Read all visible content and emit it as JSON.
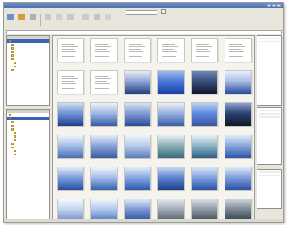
{
  "colors": {
    "accent": "#3a63b5",
    "window": "#e8e5db",
    "titlebar": "#4b6fb0"
  },
  "toolbar": {
    "buttons": [
      {
        "icon": "back-icon",
        "color": "#6b8fd1"
      },
      {
        "icon": "forward-icon",
        "color": "#d89c3c"
      },
      {
        "icon": "up-icon",
        "color": "#b0b0b0"
      },
      {
        "icon": "view-icon",
        "color": "#c7c7c7"
      },
      {
        "icon": "slideshow-icon",
        "color": "#cfcfcf"
      },
      {
        "icon": "edit-icon",
        "color": "#c9c9c9"
      },
      {
        "icon": "print-icon",
        "color": "#cbcbcb"
      },
      {
        "icon": "email-icon",
        "color": "#c4c4c4"
      },
      {
        "icon": "save-icon",
        "color": "#d0d0d0"
      }
    ]
  },
  "thumbnails": [
    {
      "kind": "doc"
    },
    {
      "kind": "doc"
    },
    {
      "kind": "doc"
    },
    {
      "kind": "doc"
    },
    {
      "kind": "doc"
    },
    {
      "kind": "doc"
    },
    {
      "kind": "doc"
    },
    {
      "kind": "doc"
    },
    {
      "kind": "photo",
      "palette": [
        "#2a3f7a",
        "#8ba6d8",
        "#e8ecf4"
      ]
    },
    {
      "kind": "photo",
      "palette": [
        "#1c3fa8",
        "#4a78d8",
        "#9eb8ea"
      ]
    },
    {
      "kind": "photo",
      "palette": [
        "#10182c",
        "#3a4d7a",
        "#6f86b7"
      ]
    },
    {
      "kind": "photo",
      "palette": [
        "#2b4d9b",
        "#a7bde6",
        "#e9eef8"
      ]
    },
    {
      "kind": "photo",
      "palette": [
        "#1f3f8f",
        "#6f93d6",
        "#cfdcf2"
      ]
    },
    {
      "kind": "photo",
      "palette": [
        "#355ba8",
        "#9eb8e4",
        "#ecf0f8"
      ]
    },
    {
      "kind": "photo",
      "palette": [
        "#2c4e98",
        "#7e9bd4",
        "#d9e2f3"
      ]
    },
    {
      "kind": "photo",
      "palette": [
        "#3c5fa6",
        "#95b0de",
        "#eef1f7"
      ]
    },
    {
      "kind": "photo",
      "palette": [
        "#3a54a0",
        "#5d88e0",
        "#bcd0f2"
      ]
    },
    {
      "kind": "photo",
      "palette": [
        "#111827",
        "#2b3f72",
        "#8ba3d4"
      ]
    },
    {
      "kind": "photo",
      "palette": [
        "#4a6fb8",
        "#a6c0e8",
        "#f1f4fa"
      ]
    },
    {
      "kind": "photo",
      "palette": [
        "#3a5ca4",
        "#8aa7da",
        "#e4eaf6"
      ]
    },
    {
      "kind": "photo",
      "palette": [
        "#5a7dbb",
        "#b8cdea",
        "#eef3fa"
      ]
    },
    {
      "kind": "photo",
      "palette": [
        "#3b6a7c",
        "#8bb0b6",
        "#e8f0f1"
      ]
    },
    {
      "kind": "photo",
      "palette": [
        "#2f5f82",
        "#8db8c8",
        "#e7f1f4"
      ]
    },
    {
      "kind": "photo",
      "palette": [
        "#2b56a6",
        "#8aa9df",
        "#dfe8f6"
      ]
    },
    {
      "kind": "photo",
      "palette": [
        "#2a4fa2",
        "#7b9ede",
        "#e2eaf7"
      ]
    },
    {
      "kind": "photo",
      "palette": [
        "#3862b0",
        "#a3bde8",
        "#f0f4fb"
      ]
    },
    {
      "kind": "photo",
      "palette": [
        "#2d59b3",
        "#86a8e3",
        "#e3ebf8"
      ]
    },
    {
      "kind": "photo",
      "palette": [
        "#203f8d",
        "#5e84cf",
        "#c8d7f0"
      ]
    },
    {
      "kind": "photo",
      "palette": [
        "#2a53aa",
        "#7fa2e0",
        "#dae5f6"
      ]
    },
    {
      "kind": "photo",
      "palette": [
        "#2d52a4",
        "#7d9fdc",
        "#e0e8f6"
      ]
    },
    {
      "kind": "photo",
      "palette": [
        "#6b86c6",
        "#c3d3ee",
        "#f4f7fc"
      ]
    },
    {
      "kind": "photo",
      "palette": [
        "#4a72c0",
        "#b0c7ee",
        "#f2f6fc"
      ]
    },
    {
      "kind": "photo",
      "palette": [
        "#2a4b96",
        "#7998d6",
        "#dde6f5"
      ]
    },
    {
      "kind": "photo",
      "palette": [
        "#4d5966",
        "#a1aab4",
        "#e3e6ea"
      ]
    },
    {
      "kind": "photo",
      "palette": [
        "#3c4652",
        "#8d98a5",
        "#d9dde2"
      ]
    },
    {
      "kind": "photo",
      "palette": [
        "#2d3948",
        "#7a8797",
        "#cdd3da"
      ]
    }
  ]
}
